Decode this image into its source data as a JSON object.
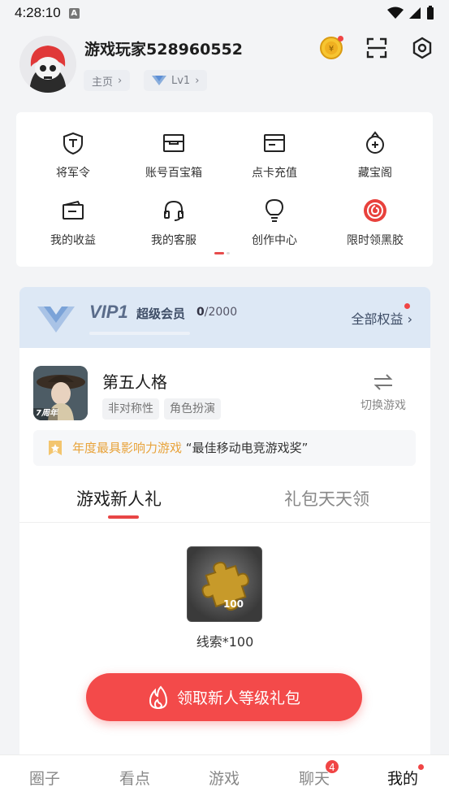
{
  "status_bar": {
    "time": "4:28:10",
    "notification_icon": "A"
  },
  "profile": {
    "username": "游戏玩家528960552",
    "home_label": "主页",
    "level_label": "Lv1"
  },
  "top_icons": [
    "coin-icon",
    "scan-icon",
    "settings-icon"
  ],
  "tools": [
    {
      "label": "将军令",
      "icon": "shield-icon"
    },
    {
      "label": "账号百宝箱",
      "icon": "treasure-box-icon"
    },
    {
      "label": "点卡充值",
      "icon": "card-icon"
    },
    {
      "label": "藏宝阁",
      "icon": "treasure-pavilion-icon"
    },
    {
      "label": "我的收益",
      "icon": "wallet-icon"
    },
    {
      "label": "我的客服",
      "icon": "headset-icon"
    },
    {
      "label": "创作中心",
      "icon": "lightbulb-icon"
    },
    {
      "label": "限时领黑胶",
      "icon": "vinyl-icon"
    }
  ],
  "vip": {
    "title": "VIP1",
    "name": "超级会员",
    "points": "0",
    "points_total": "/2000",
    "all_rights": "全部权益",
    "progress": 0
  },
  "game": {
    "name": "第五人格",
    "tags": [
      "非对称性",
      "角色扮演"
    ],
    "switch_label": "切换游戏",
    "icon_badge": "7周年",
    "award_highlight": "年度最具影响力游戏",
    "award_text": "“最佳移动电竞游戏奖”"
  },
  "gift_tabs": {
    "active": "游戏新人礼",
    "inactive": "礼包天天领"
  },
  "reward": {
    "qty_badge": "100",
    "label": "线索*100",
    "claim_button": "领取新人等级礼包"
  },
  "bottom_nav": {
    "items": [
      "圈子",
      "看点",
      "游戏",
      "聊天",
      "我的"
    ],
    "chat_badge": "4"
  },
  "colors": {
    "accent": "#f34a4a",
    "vip_bg": "#dde8f5"
  }
}
